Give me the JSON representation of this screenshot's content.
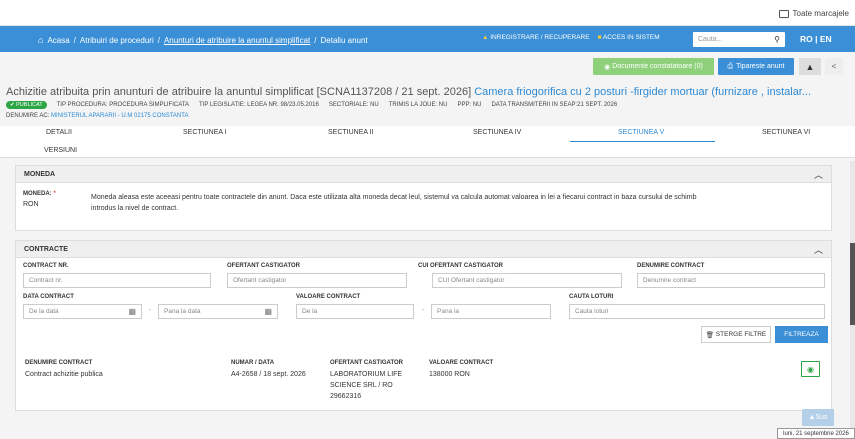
{
  "browser": {
    "bookmarks_label": "Toate marcajele"
  },
  "topnav": {
    "home": "Acasa",
    "crumb1": "Atribuiri de proceduri",
    "crumb2": "Anunturi de atribuire la anuntul simplificat",
    "crumb3": "Detaliu anunt",
    "register": "INREGISTRARE / RECUPERARE",
    "access": "ACCES IN SISTEM",
    "search_placeholder": "Cauta...",
    "lang_ro": "RO",
    "lang_sep": "|",
    "lang_en": "EN"
  },
  "actions": {
    "documents": "Documente constatatoare (0)",
    "print": "Tipareste anunt",
    "up": "▲",
    "left": "<"
  },
  "header": {
    "title_prefix": "Achizitie atribuita prin anunturi de atribuire la anuntul simplificat [SCNA1137208 / 21 sept. 2026]",
    "title_highlight": "Camera friogorifica cu 2 posturi -firgider mortuar (furnizare , instalar...",
    "status_badge": "PUBLICAT",
    "tip_procedura": "TIP PROCEDURA: PROCEDURA SIMPLIFICATA",
    "tip_legislatie": "TIP LEGISLATIE: LEGEA NR. 98/23.05.2016",
    "sectoriale": "SECTORIALE: NU",
    "trimis_joue": "TRIMIS LA JOUE: NU",
    "ppp": "PPP: NU",
    "data_trimiterii": "DATA TRANSMITERII IN SEAP:21 SEPT. 2026",
    "denumire_label": "DENUMIRE AC:",
    "denumire_value": "MINISTERUL APARARII - U.M 02175 CONSTANTA"
  },
  "tabs": [
    "DETALII",
    "SECTIUNEA I",
    "SECTIUNEA II",
    "SECTIUNEA IV",
    "SECTIUNEA V",
    "SECTIUNEA VI",
    "VERSIUNI"
  ],
  "active_tab": "SECTIUNEA V",
  "moneda": {
    "heading": "MONEDA",
    "label": "MONEDA:",
    "required": "*",
    "value": "RON",
    "description": "Moneda aleasa este aceeasi pentru toate contractele din anunt. Daca este utilizata alta moneda decat leul, sistemul va calcula automat valoarea in lei a fiecarui contract in baza cursului de schimb introdus la nivel de contract."
  },
  "contracte": {
    "heading": "CONTRACTE",
    "filters": {
      "contract_nr_label": "CONTRACT NR.",
      "contract_nr_placeholder": "Contract nr.",
      "ofertant_label": "OFERTANT CASTIGATOR",
      "ofertant_placeholder": "Ofertant castigator",
      "cui_label": "CUI OFERTANT CASTIGATOR",
      "cui_placeholder": "CUI Ofertant castigator",
      "denumire_label": "DENUMIRE CONTRACT",
      "denumire_placeholder": "Denumire contract",
      "data_label": "DATA CONTRACT",
      "data_from": "De la data",
      "data_to": "Pana la data",
      "valoare_label": "VALOARE CONTRACT",
      "valoare_from": "De la",
      "valoare_to": "Pana la",
      "loturi_label": "CAUTA LOTURI",
      "loturi_placeholder": "Cauta loturi",
      "dash": "-",
      "clear_button": "STERGE FILTRE",
      "filter_button": "FILTREAZA"
    },
    "table": {
      "headers": [
        "DENUMIRE CONTRACT",
        "NUMAR / DATA",
        "OFERTANT CASTIGATOR",
        "VALOARE CONTRACT"
      ],
      "rows": [
        {
          "denumire": "Contract achizitie publica",
          "numar_data": "A4-2658 / 18 sept. 2026",
          "ofertant": "LABORATORIUM LIFE SCIENCE SRL / RO 29662316",
          "valoare": "138000 RON"
        }
      ]
    }
  },
  "scroll_top_label": "Sus",
  "status_date": "luni, 21 septembrie 2026"
}
